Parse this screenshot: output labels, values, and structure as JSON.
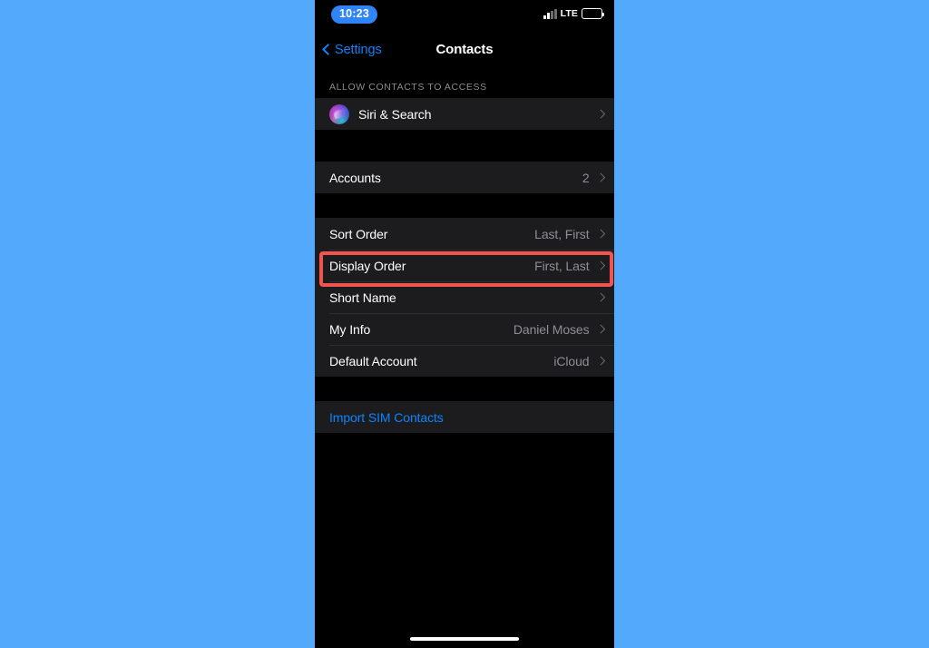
{
  "backdrop": {
    "color": "#53AAFC"
  },
  "status_bar": {
    "time": "10:23",
    "time_pill_color": "#2F84F7",
    "network_label": "LTE",
    "signal_icon": "signal-bars-icon",
    "battery_icon": "battery-icon"
  },
  "nav_bar": {
    "back_label": "Settings",
    "back_icon": "chevron-left-icon",
    "title": "Contacts",
    "accent_color": "#0A84FF"
  },
  "sections": [
    {
      "header": "ALLOW CONTACTS TO ACCESS",
      "rows": [
        {
          "label": "Siri & Search",
          "value": "",
          "icon": "siri-orb-icon",
          "accessory": "chevron-right-icon",
          "link": false
        }
      ]
    },
    {
      "header": "",
      "rows": [
        {
          "label": "Accounts",
          "value": "2",
          "icon": "",
          "accessory": "chevron-right-icon",
          "link": false
        }
      ]
    },
    {
      "header": "",
      "rows": [
        {
          "label": "Sort Order",
          "value": "Last, First",
          "icon": "",
          "accessory": "chevron-right-icon",
          "link": false
        },
        {
          "label": "Display Order",
          "value": "First, Last",
          "icon": "",
          "accessory": "chevron-right-icon",
          "link": false
        },
        {
          "label": "Short Name",
          "value": "",
          "icon": "",
          "accessory": "chevron-right-icon",
          "link": false
        },
        {
          "label": "My Info",
          "value": "Daniel Moses",
          "icon": "",
          "accessory": "chevron-right-icon",
          "link": false
        },
        {
          "label": "Default Account",
          "value": "iCloud",
          "icon": "",
          "accessory": "chevron-right-icon",
          "link": false
        }
      ]
    },
    {
      "header": "",
      "rows": [
        {
          "label": "Import SIM Contacts",
          "value": "",
          "icon": "",
          "accessory": "",
          "link": true
        }
      ]
    }
  ],
  "highlight": {
    "target_label": "Display Order",
    "color": "#F4544F"
  },
  "home_indicator": {
    "present": true
  }
}
